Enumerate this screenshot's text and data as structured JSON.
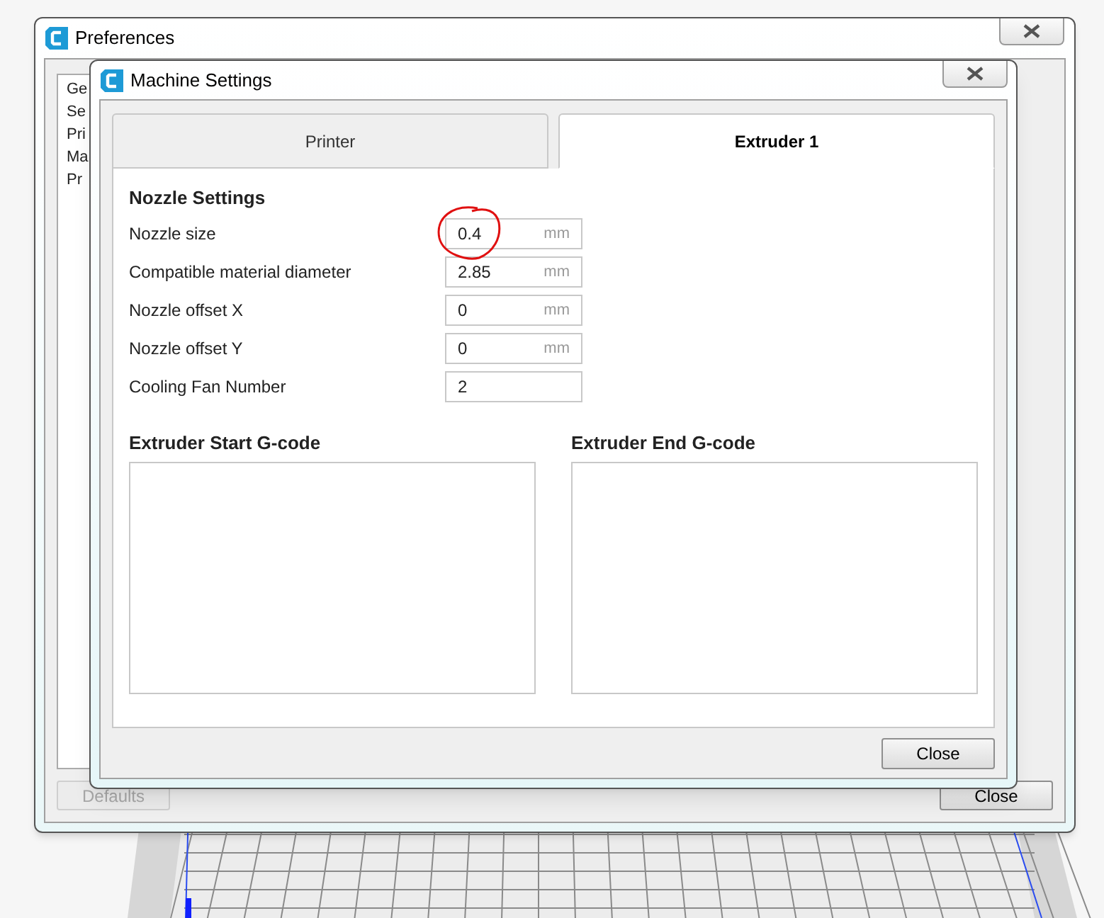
{
  "preferences": {
    "title": "Preferences",
    "sidebar": {
      "items": [
        {
          "label": "Ge"
        },
        {
          "label": "Se"
        },
        {
          "label": "Pri"
        },
        {
          "label": "Ma"
        },
        {
          "label": "Pr"
        }
      ]
    },
    "buttons": [
      {
        "label": "Defaults",
        "disabled": true
      },
      {
        "label": "Close",
        "disabled": false
      }
    ]
  },
  "machine_settings": {
    "title": "Machine Settings",
    "tabs": [
      {
        "label": "Printer",
        "selected": false
      },
      {
        "label": "Extruder 1",
        "selected": true
      }
    ],
    "section_title": "Nozzle Settings",
    "fields": [
      {
        "label": "Nozzle size",
        "value": "0.4",
        "unit": "mm"
      },
      {
        "label": "Compatible material diameter",
        "value": "2.85",
        "unit": "mm"
      },
      {
        "label": "Nozzle offset X",
        "value": "0",
        "unit": "mm"
      },
      {
        "label": "Nozzle offset Y",
        "value": "0",
        "unit": "mm"
      },
      {
        "label": "Cooling Fan Number",
        "value": "2"
      }
    ],
    "gcode": [
      {
        "title": "Extruder Start G-code"
      },
      {
        "title": "Extruder End G-code"
      }
    ],
    "close_button": "Close"
  }
}
